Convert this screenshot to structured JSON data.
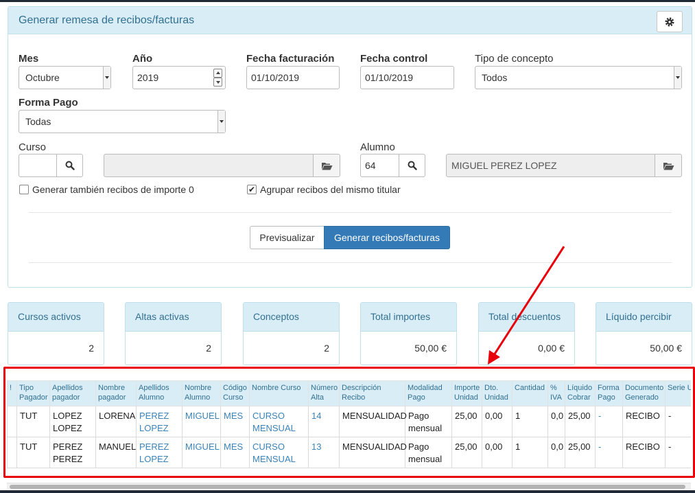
{
  "panel": {
    "title": "Generar remesa de recibos/facturas",
    "settings_icon": "gear-icon"
  },
  "form": {
    "mes": {
      "label": "Mes",
      "value": "Octubre"
    },
    "anio": {
      "label": "Año",
      "value": "2019"
    },
    "fecha_facturacion": {
      "label": "Fecha facturación",
      "value": "01/10/2019"
    },
    "fecha_control": {
      "label": "Fecha control",
      "value": "01/10/2019"
    },
    "tipo_concepto": {
      "label": "Tipo de concepto",
      "value": "Todos"
    },
    "forma_pago": {
      "label": "Forma Pago",
      "value": "Todas"
    },
    "curso": {
      "label": "Curso",
      "code": "",
      "name": ""
    },
    "alumno": {
      "label": "Alumno",
      "code": "64",
      "name": "MIGUEL PEREZ LOPEZ"
    },
    "check_importe0": {
      "label": "Generar también recibos de importe 0",
      "checked": false
    },
    "check_agrupar": {
      "label": "Agrupar recibos del mismo titular",
      "checked": true
    }
  },
  "actions": {
    "preview_label": "Previsualizar",
    "generate_label": "Generar recibos/facturas"
  },
  "stats": [
    {
      "label": "Cursos activos",
      "value": "2"
    },
    {
      "label": "Altas activas",
      "value": "2"
    },
    {
      "label": "Conceptos",
      "value": "2"
    },
    {
      "label": "Total importes",
      "value": "50,00 €"
    },
    {
      "label": "Total descuentos",
      "value": "0,00 €"
    },
    {
      "label": "Líquido percibir",
      "value": "50,00 €"
    }
  ],
  "table": {
    "headers": [
      "!",
      "Tipo Pagador",
      "Apellidos pagador",
      "Nombre pagador",
      "Apellidos Alumno",
      "Nombre Alumno",
      "Código Curso",
      "Nombre Curso",
      "Número Alta",
      "Descripción Recibo",
      "Modalidad Pago",
      "Importe Unidad",
      "Dto. Unidad",
      "Cantidad",
      "% IVA",
      "Líquido Cobrar",
      "Forma Pago",
      "Documento Generado",
      "Serie Usada"
    ],
    "rows": [
      [
        "",
        "TUT",
        "LOPEZ LOPEZ",
        "LORENA",
        "PEREZ LOPEZ",
        "MIGUEL",
        "MES",
        "CURSO MENSUAL",
        "14",
        "MENSUALIDAD",
        "Pago mensual",
        "25,00",
        "0,00",
        "1",
        "0,0",
        "25,00",
        "-",
        "RECIBO",
        "-"
      ],
      [
        "",
        "TUT",
        "PEREZ PEREZ",
        "MANUEL",
        "PEREZ LOPEZ",
        "MIGUEL",
        "MES",
        "CURSO MENSUAL",
        "13",
        "MENSUALIDAD",
        "Pago mensual",
        "25,00",
        "0,00",
        "1",
        "0,0",
        "25,00",
        "-",
        "RECIBO",
        "-"
      ]
    ]
  },
  "annotation_color": "#e8000b"
}
